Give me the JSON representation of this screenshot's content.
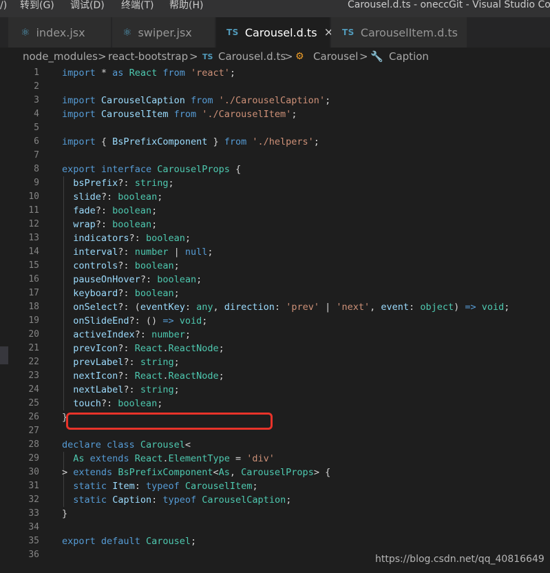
{
  "menu": {
    "items": [
      "/)",
      "转到(G)",
      "调试(D)",
      "终端(T)",
      "帮助(H)"
    ]
  },
  "window": {
    "title": "Carousel.d.ts - oneccGit - Visual Studio Code"
  },
  "tabs": [
    {
      "label": "index.jsx",
      "icon": "react-icon"
    },
    {
      "label": "swiper.jsx",
      "icon": "react-icon"
    },
    {
      "label": "Carousel.d.ts",
      "icon": "ts-icon",
      "icon_text": "TS",
      "close": "×",
      "active": true
    },
    {
      "label": "CarouselItem.d.ts",
      "icon": "ts-icon",
      "icon_text": "TS"
    }
  ],
  "breadcrumb": {
    "items": [
      "node_modules",
      "react-bootstrap",
      "Carousel.d.ts",
      "Carousel",
      "Caption"
    ],
    "separator": ">",
    "ts_icon_text": "TS"
  },
  "line_numbers": [
    "1",
    "2",
    "3",
    "4",
    "5",
    "6",
    "7",
    "8",
    "9",
    "10",
    "11",
    "12",
    "13",
    "14",
    "15",
    "16",
    "17",
    "18",
    "19",
    "20",
    "21",
    "22",
    "23",
    "24",
    "25",
    "26",
    "27",
    "28",
    "29",
    "30",
    "31",
    "32",
    "33",
    "34",
    "35",
    "36"
  ],
  "code_lines": [
    [
      [
        "kw",
        "import"
      ],
      [
        "pn",
        " * "
      ],
      [
        "kw",
        "as"
      ],
      [
        "pn",
        " "
      ],
      [
        "ty",
        "React"
      ],
      [
        "pn",
        " "
      ],
      [
        "kw",
        "from"
      ],
      [
        "pn",
        " "
      ],
      [
        "str",
        "'react'"
      ],
      [
        "pn",
        ";"
      ]
    ],
    [],
    [
      [
        "kw",
        "import"
      ],
      [
        "pn",
        " "
      ],
      [
        "id",
        "CarouselCaption"
      ],
      [
        "pn",
        " "
      ],
      [
        "kw",
        "from"
      ],
      [
        "pn",
        " "
      ],
      [
        "str",
        "'./CarouselCaption'"
      ],
      [
        "pn",
        ";"
      ]
    ],
    [
      [
        "kw",
        "import"
      ],
      [
        "pn",
        " "
      ],
      [
        "id",
        "CarouselItem"
      ],
      [
        "pn",
        " "
      ],
      [
        "kw",
        "from"
      ],
      [
        "pn",
        " "
      ],
      [
        "str",
        "'./CarouselItem'"
      ],
      [
        "pn",
        ";"
      ]
    ],
    [],
    [
      [
        "kw",
        "import"
      ],
      [
        "pn",
        " { "
      ],
      [
        "id",
        "BsPrefixComponent"
      ],
      [
        "pn",
        " } "
      ],
      [
        "kw",
        "from"
      ],
      [
        "pn",
        " "
      ],
      [
        "str",
        "'./helpers'"
      ],
      [
        "pn",
        ";"
      ]
    ],
    [],
    [
      [
        "kw",
        "export"
      ],
      [
        "pn",
        " "
      ],
      [
        "kw",
        "interface"
      ],
      [
        "pn",
        " "
      ],
      [
        "ty",
        "CarouselProps"
      ],
      [
        "pn",
        " {"
      ]
    ],
    [
      [
        "pn",
        "  "
      ],
      [
        "id",
        "bsPrefix"
      ],
      [
        "pn",
        "?: "
      ],
      [
        "ty",
        "string"
      ],
      [
        "pn",
        ";"
      ]
    ],
    [
      [
        "pn",
        "  "
      ],
      [
        "id",
        "slide"
      ],
      [
        "pn",
        "?: "
      ],
      [
        "ty",
        "boolean"
      ],
      [
        "pn",
        ";"
      ]
    ],
    [
      [
        "pn",
        "  "
      ],
      [
        "id",
        "fade"
      ],
      [
        "pn",
        "?: "
      ],
      [
        "ty",
        "boolean"
      ],
      [
        "pn",
        ";"
      ]
    ],
    [
      [
        "pn",
        "  "
      ],
      [
        "id",
        "wrap"
      ],
      [
        "pn",
        "?: "
      ],
      [
        "ty",
        "boolean"
      ],
      [
        "pn",
        ";"
      ]
    ],
    [
      [
        "pn",
        "  "
      ],
      [
        "id",
        "indicators"
      ],
      [
        "pn",
        "?: "
      ],
      [
        "ty",
        "boolean"
      ],
      [
        "pn",
        ";"
      ]
    ],
    [
      [
        "pn",
        "  "
      ],
      [
        "id",
        "interval"
      ],
      [
        "pn",
        "?: "
      ],
      [
        "ty",
        "number"
      ],
      [
        "pn",
        " | "
      ],
      [
        "kw",
        "null"
      ],
      [
        "pn",
        ";"
      ]
    ],
    [
      [
        "pn",
        "  "
      ],
      [
        "id",
        "controls"
      ],
      [
        "pn",
        "?: "
      ],
      [
        "ty",
        "boolean"
      ],
      [
        "pn",
        ";"
      ]
    ],
    [
      [
        "pn",
        "  "
      ],
      [
        "id",
        "pauseOnHover"
      ],
      [
        "pn",
        "?: "
      ],
      [
        "ty",
        "boolean"
      ],
      [
        "pn",
        ";"
      ]
    ],
    [
      [
        "pn",
        "  "
      ],
      [
        "id",
        "keyboard"
      ],
      [
        "pn",
        "?: "
      ],
      [
        "ty",
        "boolean"
      ],
      [
        "pn",
        ";"
      ]
    ],
    [
      [
        "pn",
        "  "
      ],
      [
        "id",
        "onSelect"
      ],
      [
        "pn",
        "?: ("
      ],
      [
        "id",
        "eventKey"
      ],
      [
        "pn",
        ": "
      ],
      [
        "ty",
        "any"
      ],
      [
        "pn",
        ", "
      ],
      [
        "id",
        "direction"
      ],
      [
        "pn",
        ": "
      ],
      [
        "str",
        "'prev'"
      ],
      [
        "pn",
        " | "
      ],
      [
        "str",
        "'next'"
      ],
      [
        "pn",
        ", "
      ],
      [
        "id",
        "event"
      ],
      [
        "pn",
        ": "
      ],
      [
        "ty",
        "object"
      ],
      [
        "pn",
        ") "
      ],
      [
        "kw",
        "=>"
      ],
      [
        "pn",
        " "
      ],
      [
        "ty",
        "void"
      ],
      [
        "pn",
        ";"
      ]
    ],
    [
      [
        "pn",
        "  "
      ],
      [
        "id",
        "onSlideEnd"
      ],
      [
        "pn",
        "?: () "
      ],
      [
        "kw",
        "=>"
      ],
      [
        "pn",
        " "
      ],
      [
        "ty",
        "void"
      ],
      [
        "pn",
        ";"
      ]
    ],
    [
      [
        "pn",
        "  "
      ],
      [
        "id",
        "activeIndex"
      ],
      [
        "pn",
        "?: "
      ],
      [
        "ty",
        "number"
      ],
      [
        "pn",
        ";"
      ]
    ],
    [
      [
        "pn",
        "  "
      ],
      [
        "id",
        "prevIcon"
      ],
      [
        "pn",
        "?: "
      ],
      [
        "ty",
        "React"
      ],
      [
        "pn",
        "."
      ],
      [
        "ty",
        "ReactNode"
      ],
      [
        "pn",
        ";"
      ]
    ],
    [
      [
        "pn",
        "  "
      ],
      [
        "id",
        "prevLabel"
      ],
      [
        "pn",
        "?: "
      ],
      [
        "ty",
        "string"
      ],
      [
        "pn",
        ";"
      ]
    ],
    [
      [
        "pn",
        "  "
      ],
      [
        "id",
        "nextIcon"
      ],
      [
        "pn",
        "?: "
      ],
      [
        "ty",
        "React"
      ],
      [
        "pn",
        "."
      ],
      [
        "ty",
        "ReactNode"
      ],
      [
        "pn",
        ";"
      ]
    ],
    [
      [
        "pn",
        "  "
      ],
      [
        "id",
        "nextLabel"
      ],
      [
        "pn",
        "?: "
      ],
      [
        "ty",
        "string"
      ],
      [
        "pn",
        ";"
      ]
    ],
    [
      [
        "pn",
        "  "
      ],
      [
        "id",
        "touch"
      ],
      [
        "pn",
        "?: "
      ],
      [
        "ty",
        "boolean"
      ],
      [
        "pn",
        ";"
      ]
    ],
    [
      [
        "pn",
        "}"
      ]
    ],
    [],
    [
      [
        "kw",
        "declare"
      ],
      [
        "pn",
        " "
      ],
      [
        "kw",
        "class"
      ],
      [
        "pn",
        " "
      ],
      [
        "ty",
        "Carousel"
      ],
      [
        "pn",
        "<"
      ]
    ],
    [
      [
        "pn",
        "  "
      ],
      [
        "ty",
        "As"
      ],
      [
        "pn",
        " "
      ],
      [
        "kw",
        "extends"
      ],
      [
        "pn",
        " "
      ],
      [
        "ty",
        "React"
      ],
      [
        "pn",
        "."
      ],
      [
        "ty",
        "ElementType"
      ],
      [
        "pn",
        " = "
      ],
      [
        "str",
        "'div'"
      ]
    ],
    [
      [
        "pn",
        "> "
      ],
      [
        "kw",
        "extends"
      ],
      [
        "pn",
        " "
      ],
      [
        "ty",
        "BsPrefixComponent"
      ],
      [
        "pn",
        "<"
      ],
      [
        "ty",
        "As"
      ],
      [
        "pn",
        ", "
      ],
      [
        "ty",
        "CarouselProps"
      ],
      [
        "pn",
        "> {"
      ]
    ],
    [
      [
        "pn",
        "  "
      ],
      [
        "kw",
        "static"
      ],
      [
        "pn",
        " "
      ],
      [
        "id",
        "Item"
      ],
      [
        "pn",
        ": "
      ],
      [
        "kw",
        "typeof"
      ],
      [
        "pn",
        " "
      ],
      [
        "ty",
        "CarouselItem"
      ],
      [
        "pn",
        ";"
      ]
    ],
    [
      [
        "pn",
        "  "
      ],
      [
        "kw",
        "static"
      ],
      [
        "pn",
        " "
      ],
      [
        "id",
        "Caption"
      ],
      [
        "pn",
        ": "
      ],
      [
        "kw",
        "typeof"
      ],
      [
        "pn",
        " "
      ],
      [
        "ty",
        "CarouselCaption"
      ],
      [
        "pn",
        ";"
      ]
    ],
    [
      [
        "pn",
        "}"
      ]
    ],
    [],
    [
      [
        "kw",
        "export"
      ],
      [
        "pn",
        " "
      ],
      [
        "kw",
        "default"
      ],
      [
        "pn",
        " "
      ],
      [
        "ty",
        "Carousel"
      ],
      [
        "pn",
        ";"
      ]
    ],
    []
  ],
  "watermark": "https://blog.csdn.net/qq_40816649",
  "colors": {
    "editor_bg": "#1e1e1e",
    "keyword": "#569cd6",
    "string": "#ce9178",
    "identifier": "#9cdcfe",
    "type": "#4ec9b0",
    "highlight_box": "#e8332a"
  }
}
